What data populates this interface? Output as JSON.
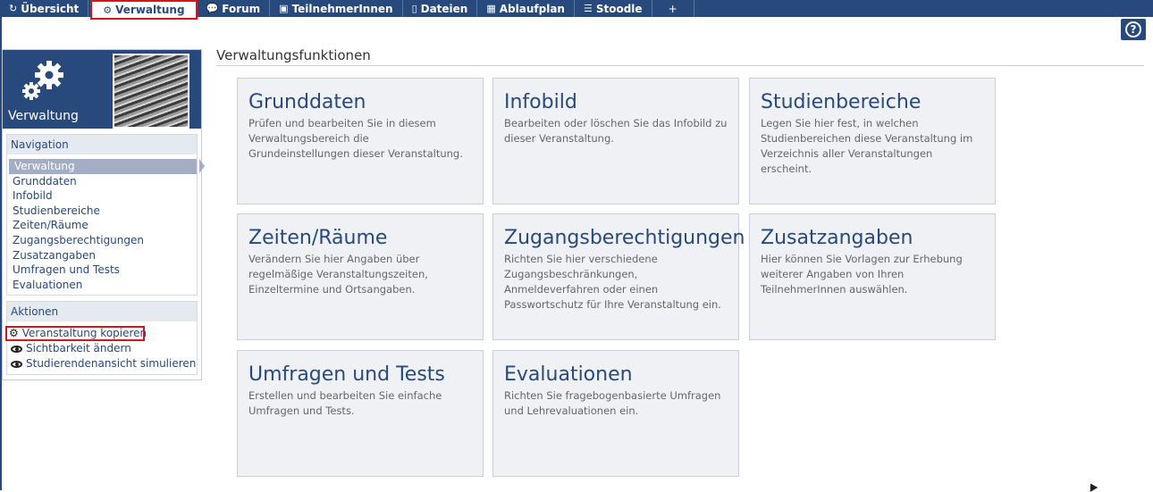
{
  "tabs": [
    {
      "label": "Übersicht",
      "icon": "overview-icon"
    },
    {
      "label": "Verwaltung",
      "icon": "gears-icon",
      "active": true
    },
    {
      "label": "Forum",
      "icon": "forum-icon"
    },
    {
      "label": "TeilnehmerInnen",
      "icon": "participants-icon"
    },
    {
      "label": "Dateien",
      "icon": "files-icon"
    },
    {
      "label": "Ablaufplan",
      "icon": "schedule-icon"
    },
    {
      "label": "Stoodle",
      "icon": "stoodle-icon"
    },
    {
      "label": "+",
      "icon": "plus-icon"
    }
  ],
  "help": {
    "label": "?"
  },
  "sidebar": {
    "header_title": "Verwaltung",
    "navigation": {
      "title": "Navigation",
      "items": [
        "Verwaltung",
        "Grunddaten",
        "Infobild",
        "Studienbereiche",
        "Zeiten/Räume",
        "Zugangsberechtigungen",
        "Zusatzangaben",
        "Umfragen und Tests",
        "Evaluationen"
      ]
    },
    "actions": {
      "title": "Aktionen",
      "items": [
        "Veranstaltung kopieren",
        "Sichtbarkeit ändern",
        "Studierendenansicht simulieren"
      ]
    }
  },
  "main": {
    "title": "Verwaltungsfunktionen",
    "cards": [
      {
        "title": "Grunddaten",
        "desc": "Prüfen und bearbeiten Sie in diesem Verwaltungsbereich die Grundeinstellungen dieser Veranstaltung."
      },
      {
        "title": "Infobild",
        "desc": "Bearbeiten oder löschen Sie das Infobild zu dieser Veranstaltung."
      },
      {
        "title": "Studienbereiche",
        "desc": "Legen Sie hier fest, in welchen Studienbereichen diese Veranstaltung im Verzeichnis aller Veranstaltungen erscheint."
      },
      {
        "title": "Zeiten/Räume",
        "desc": "Verändern Sie hier Angaben über regelmäßige Veranstaltungszeiten, Einzeltermine und Ortsangaben."
      },
      {
        "title": "Zugangsberechtigungen",
        "desc": "Richten Sie hier verschiedene Zugangsbeschränkungen, Anmeldeverfahren oder einen Passwortschutz für Ihre Veranstaltung ein."
      },
      {
        "title": "Zusatzangaben",
        "desc": "Hier können Sie Vorlagen zur Erhebung weiterer Angaben von Ihren TeilnehmerInnen auswählen."
      },
      {
        "title": "Umfragen und Tests",
        "desc": "Erstellen und bearbeiten Sie einfache Umfragen und Tests."
      },
      {
        "title": "Evaluationen",
        "desc": "Richten Sie fragebogenbasierte Umfragen und Lehrevaluationen ein."
      }
    ]
  },
  "colors": {
    "brand": "#28497c",
    "highlight": "#d9141c",
    "card_bg": "#eff1f5"
  }
}
